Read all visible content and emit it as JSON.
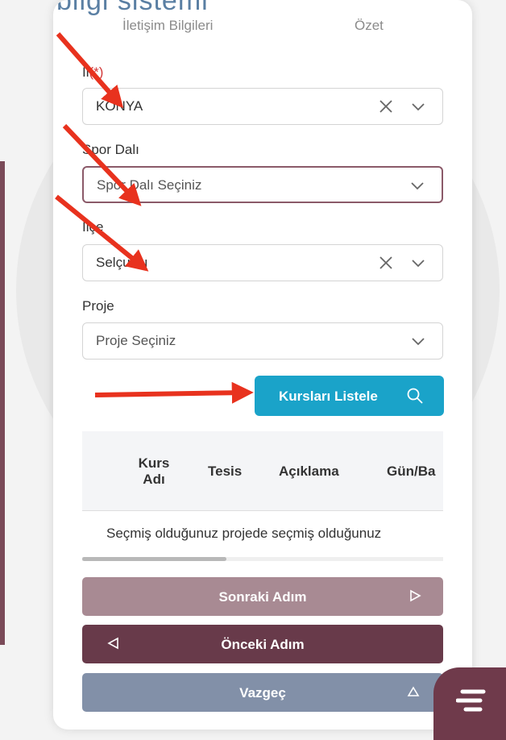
{
  "header": {
    "app_title": "bilgi sistemi",
    "steps": [
      "İletişim Bilgileri",
      "Özet"
    ]
  },
  "form": {
    "il": {
      "label": "İl",
      "required_mark": "(*)",
      "value": "KONYA"
    },
    "spor_dali": {
      "label": "Spor Dalı",
      "placeholder": "Spor Dalı Seçiniz"
    },
    "ilce": {
      "label": "İlçe",
      "value": "Selçuklu"
    },
    "proje": {
      "label": "Proje",
      "placeholder": "Proje Seçiniz"
    }
  },
  "list_button": {
    "label": "Kursları Listele",
    "icon": "search-icon"
  },
  "table": {
    "columns": [
      "Kurs Adı",
      "Tesis",
      "Açıklama",
      "Gün/Ba"
    ],
    "notice": "Seçmiş olduğunuz projede seçmiş olduğunuz",
    "scroll_fraction": 0.4
  },
  "nav": {
    "next_label": "Sonraki Adım",
    "prev_label": "Önceki Adım",
    "cancel_label": "Vazgeç"
  },
  "colors": {
    "accent": "#1aa3c9",
    "next": "#a88a93",
    "prev": "#683a4a",
    "cancel": "#8290a8",
    "arrow": "#e8321e"
  },
  "icons": [
    "clear-icon",
    "chevron-down-icon",
    "search-icon",
    "play-right-icon",
    "play-left-icon",
    "triangle-up-icon",
    "menu-icon"
  ]
}
